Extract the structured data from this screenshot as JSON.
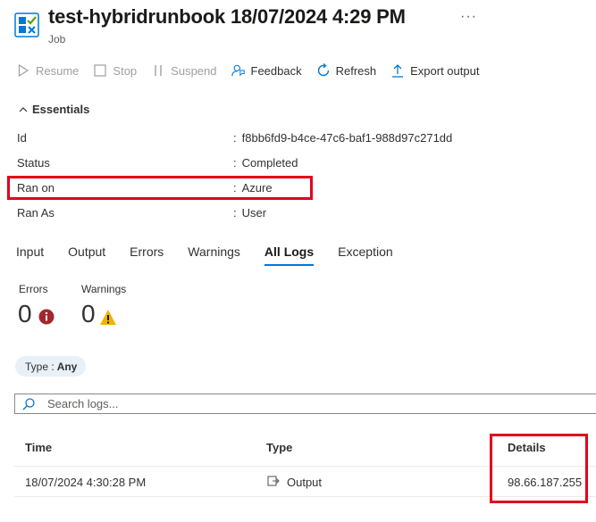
{
  "header": {
    "title": "test-hybridrunbook 18/07/2024 4:29 PM",
    "subtitle": "Job",
    "more": "···"
  },
  "toolbar": {
    "resume": "Resume",
    "stop": "Stop",
    "suspend": "Suspend",
    "feedback": "Feedback",
    "refresh": "Refresh",
    "export": "Export output"
  },
  "essentials": {
    "header": "Essentials",
    "rows": [
      {
        "label": "Id",
        "value": "f8bb6fd9-b4ce-47c6-baf1-988d97c271dd"
      },
      {
        "label": "Status",
        "value": "Completed"
      },
      {
        "label": "Ran on",
        "value": "Azure"
      },
      {
        "label": "Ran As",
        "value": "User"
      }
    ]
  },
  "tabs": [
    "Input",
    "Output",
    "Errors",
    "Warnings",
    "All Logs",
    "Exception"
  ],
  "active_tab": "All Logs",
  "counts": {
    "errors_label": "Errors",
    "errors_value": "0",
    "warnings_label": "Warnings",
    "warnings_value": "0"
  },
  "filter": {
    "label": "Type :",
    "value": "Any"
  },
  "search": {
    "placeholder": "Search logs..."
  },
  "table": {
    "columns": [
      "Time",
      "Type",
      "Details"
    ],
    "rows": [
      {
        "time": "18/07/2024 4:30:28 PM",
        "type": "Output",
        "details": "98.66.187.255"
      }
    ]
  },
  "colors": {
    "accent": "#0078d4",
    "highlight": "#e3001b",
    "error": "#a4262c",
    "warning": "#f2b200"
  }
}
